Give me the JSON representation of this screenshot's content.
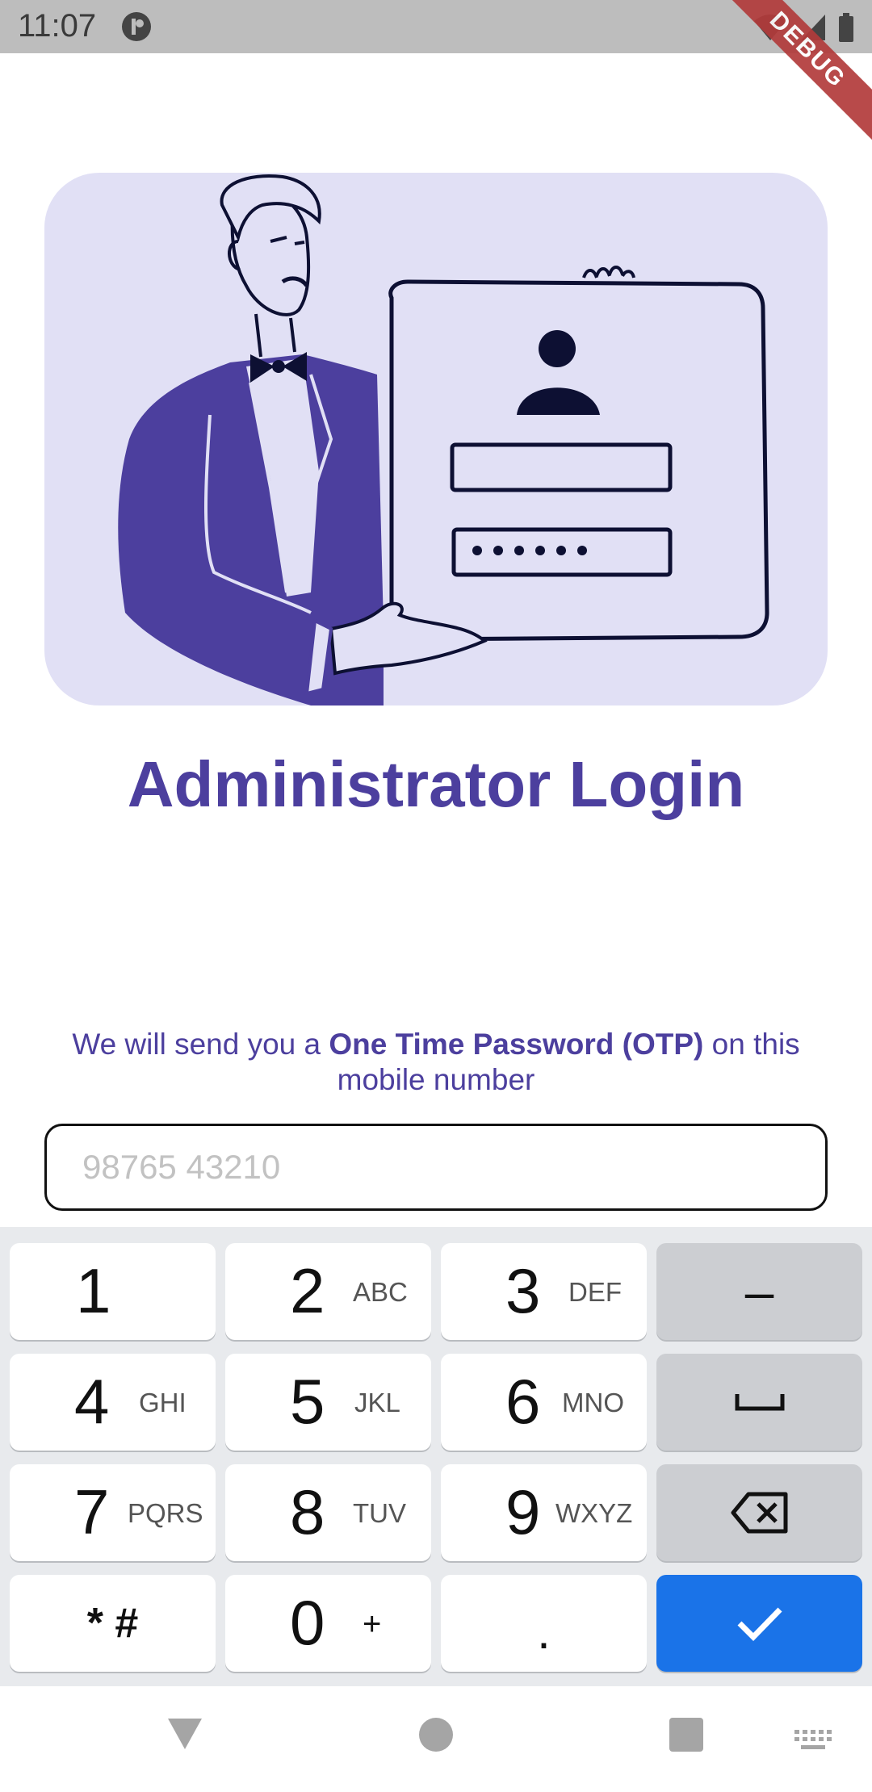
{
  "status_bar": {
    "time": "11:07",
    "debug_label": "DEBUG"
  },
  "hero": {
    "illustration": "administrator-holding-login-card"
  },
  "login": {
    "title": "Administrator Login",
    "otp_prefix": "We will send you a ",
    "otp_bold": "One Time Password (OTP)",
    "otp_suffix": " on this mobile number",
    "phone_placeholder": "98765 43210"
  },
  "keyboard": {
    "rows": [
      [
        {
          "num": "1",
          "letters": ""
        },
        {
          "num": "2",
          "letters": "ABC"
        },
        {
          "num": "3",
          "letters": "DEF"
        },
        {
          "label": "–",
          "name": "dash-key"
        }
      ],
      [
        {
          "num": "4",
          "letters": "GHI"
        },
        {
          "num": "5",
          "letters": "JKL"
        },
        {
          "num": "6",
          "letters": "MNO"
        },
        {
          "icon": "space-icon"
        }
      ],
      [
        {
          "num": "7",
          "letters": "PQRS"
        },
        {
          "num": "8",
          "letters": "TUV"
        },
        {
          "num": "9",
          "letters": "WXYZ"
        },
        {
          "icon": "backspace-icon"
        }
      ],
      [
        {
          "label": "* #"
        },
        {
          "num": "0",
          "letters": "+"
        },
        {
          "label": "."
        },
        {
          "icon": "check-icon"
        }
      ]
    ]
  },
  "nav": {
    "icons": [
      "back-icon",
      "home-icon",
      "recents-icon",
      "keyboard-switch-icon"
    ]
  },
  "colors": {
    "accent": "#4c3f9e",
    "card_bg": "#e1e0f5",
    "enter_key": "#1a73e8"
  }
}
